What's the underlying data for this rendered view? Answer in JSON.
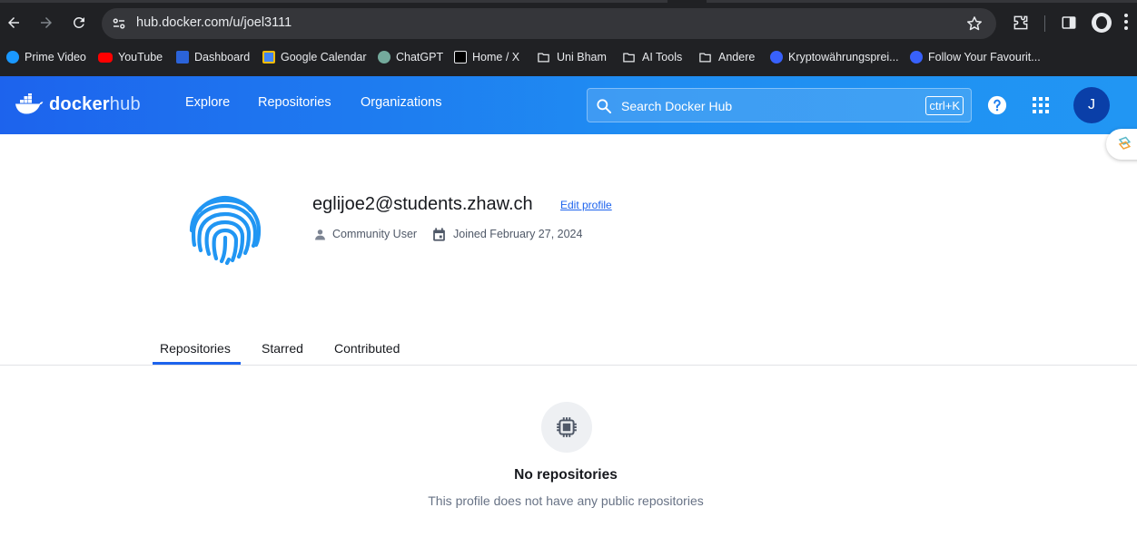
{
  "browser": {
    "url": "hub.docker.com/u/joel3111",
    "bookmarks": [
      {
        "label": "Prime Video",
        "icon": "prime-video-icon"
      },
      {
        "label": "YouTube",
        "icon": "youtube-icon"
      },
      {
        "label": "Dashboard",
        "icon": "dashboard-icon"
      },
      {
        "label": "Google Calendar",
        "icon": "google-calendar-icon"
      },
      {
        "label": "ChatGPT",
        "icon": "chatgpt-icon"
      },
      {
        "label": "Home / X",
        "icon": "x-icon"
      },
      {
        "label": "Uni Bham",
        "icon": "folder-icon"
      },
      {
        "label": "AI Tools",
        "icon": "folder-icon"
      },
      {
        "label": "Andere",
        "icon": "folder-icon"
      },
      {
        "label": "Kryptowährungsprei...",
        "icon": "coinmarketcap-icon"
      },
      {
        "label": "Follow Your Favourit...",
        "icon": "coinmarketcap-icon"
      }
    ]
  },
  "header": {
    "logo_docker": "docker",
    "logo_hub": "hub",
    "nav": [
      "Explore",
      "Repositories",
      "Organizations"
    ],
    "search_placeholder": "Search Docker Hub",
    "search_shortcut": "ctrl+K",
    "avatar_initial": "J",
    "brand_color": "#1d63ed"
  },
  "profile": {
    "name": "eglijoe2@students.zhaw.ch",
    "edit_link": "Edit profile",
    "role": "Community User",
    "joined": "Joined February 27, 2024"
  },
  "tabs": [
    {
      "label": "Repositories",
      "active": true
    },
    {
      "label": "Starred",
      "active": false
    },
    {
      "label": "Contributed",
      "active": false
    }
  ],
  "empty_state": {
    "icon": "chip-icon",
    "title": "No repositories",
    "subtitle": "This profile does not have any public repositories"
  }
}
